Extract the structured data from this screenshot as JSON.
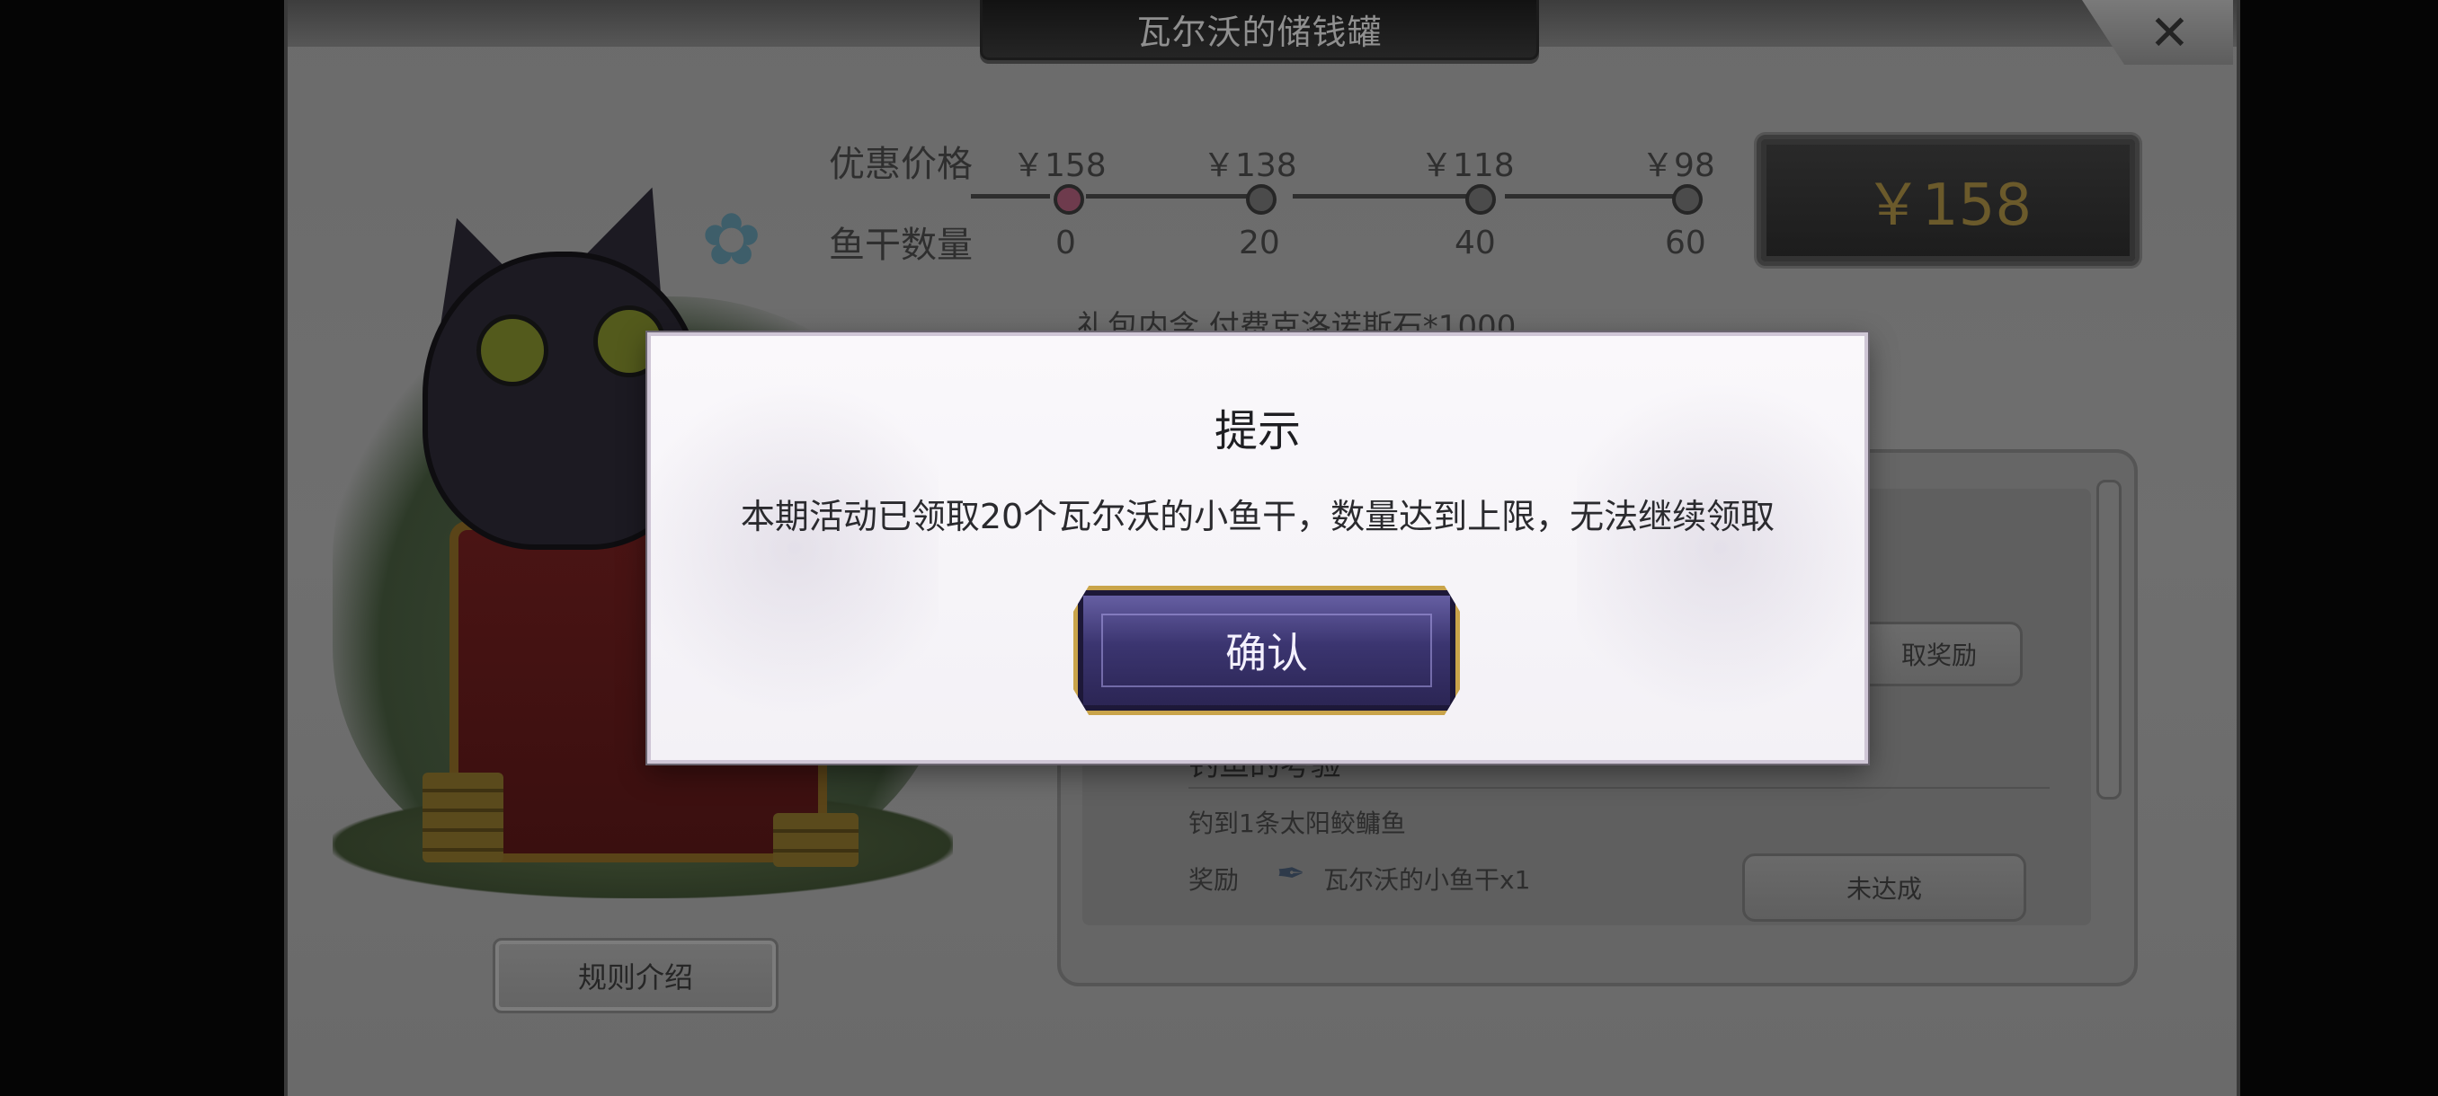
{
  "header": {
    "title": "瓦尔沃的储钱罐",
    "close_icon": "✕"
  },
  "pricing": {
    "price_label": "优惠价格",
    "fish_label": "鱼干数量",
    "tiers": [
      {
        "price": "￥158",
        "fish": "0"
      },
      {
        "price": "￥138",
        "fish": "20"
      },
      {
        "price": "￥118",
        "fish": "40"
      },
      {
        "price": "￥98",
        "fish": "60"
      }
    ],
    "current_price": "￥158",
    "gift_text": "礼包内含 付费克洛诺斯石*1000"
  },
  "left": {
    "rules_button": "规则介绍"
  },
  "tasks": {
    "claimed_button": "取奖励",
    "task2_title": "钓鱼的考验",
    "task2_desc": "钓到1条太阳鲛鳙鱼",
    "reward_label": "奖励",
    "reward_item": "瓦尔沃的小鱼干x1",
    "task2_button": "未达成"
  },
  "dialog": {
    "title": "提示",
    "message": "本期活动已领取20个瓦尔沃的小鱼干，数量达到上限，无法继续领取",
    "confirm": "确认"
  },
  "colors": {
    "dialog_bg": "#f6f4f8",
    "confirm_btn": "#3b3570",
    "confirm_border": "#c9a44a",
    "dim_overlay": "#6a6a6a"
  }
}
